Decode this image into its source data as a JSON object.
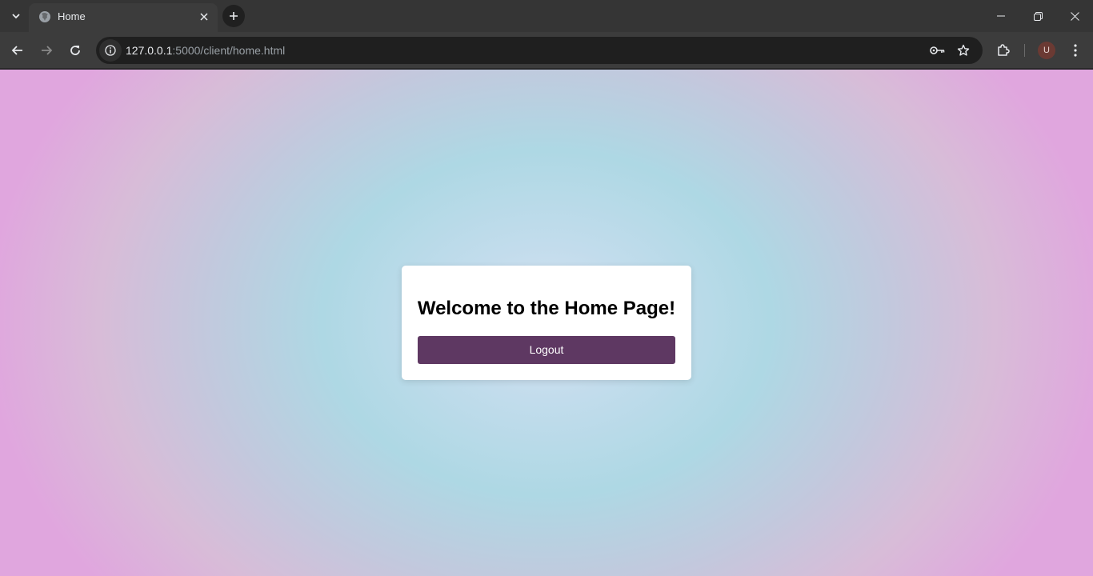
{
  "browser": {
    "tab": {
      "title": "Home",
      "favicon": "globe-icon"
    },
    "url": {
      "host": "127.0.0.1",
      "path": ":5000/client/home.html"
    },
    "profile": {
      "initial": "U"
    },
    "colors": {
      "tabstrip": "#353535",
      "toolbar": "#3c3c3c",
      "omnibox": "#1f1f1f"
    }
  },
  "page": {
    "heading": "Welcome to the Home Page!",
    "logout_label": "Logout",
    "colors": {
      "button": "#5e3862",
      "card": "#ffffff"
    }
  }
}
